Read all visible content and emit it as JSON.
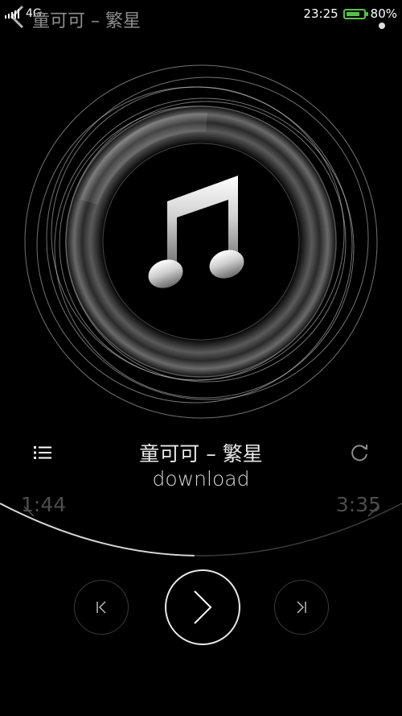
{
  "status": {
    "network": "4G",
    "time": "23:25",
    "battery": "80%",
    "battery_level": 0.8
  },
  "header": {
    "title": "童可可 – 繁星"
  },
  "song": {
    "title": "童可可 – 繁星",
    "subtitle": "download"
  },
  "progress": {
    "elapsed": "1:44",
    "total": "3:35",
    "fraction": 0.484
  },
  "icons": {
    "back": "chevron-left-icon",
    "more": "dot-icon",
    "playlist": "list-icon",
    "repeat": "repeat-icon",
    "previous": "skip-previous-icon",
    "play": "play-icon",
    "next": "skip-next-icon",
    "artwork": "music-note-icon"
  },
  "colors": {
    "background": "#000000",
    "battery": "#55c24a",
    "text_dim": "#4c4c4c"
  }
}
